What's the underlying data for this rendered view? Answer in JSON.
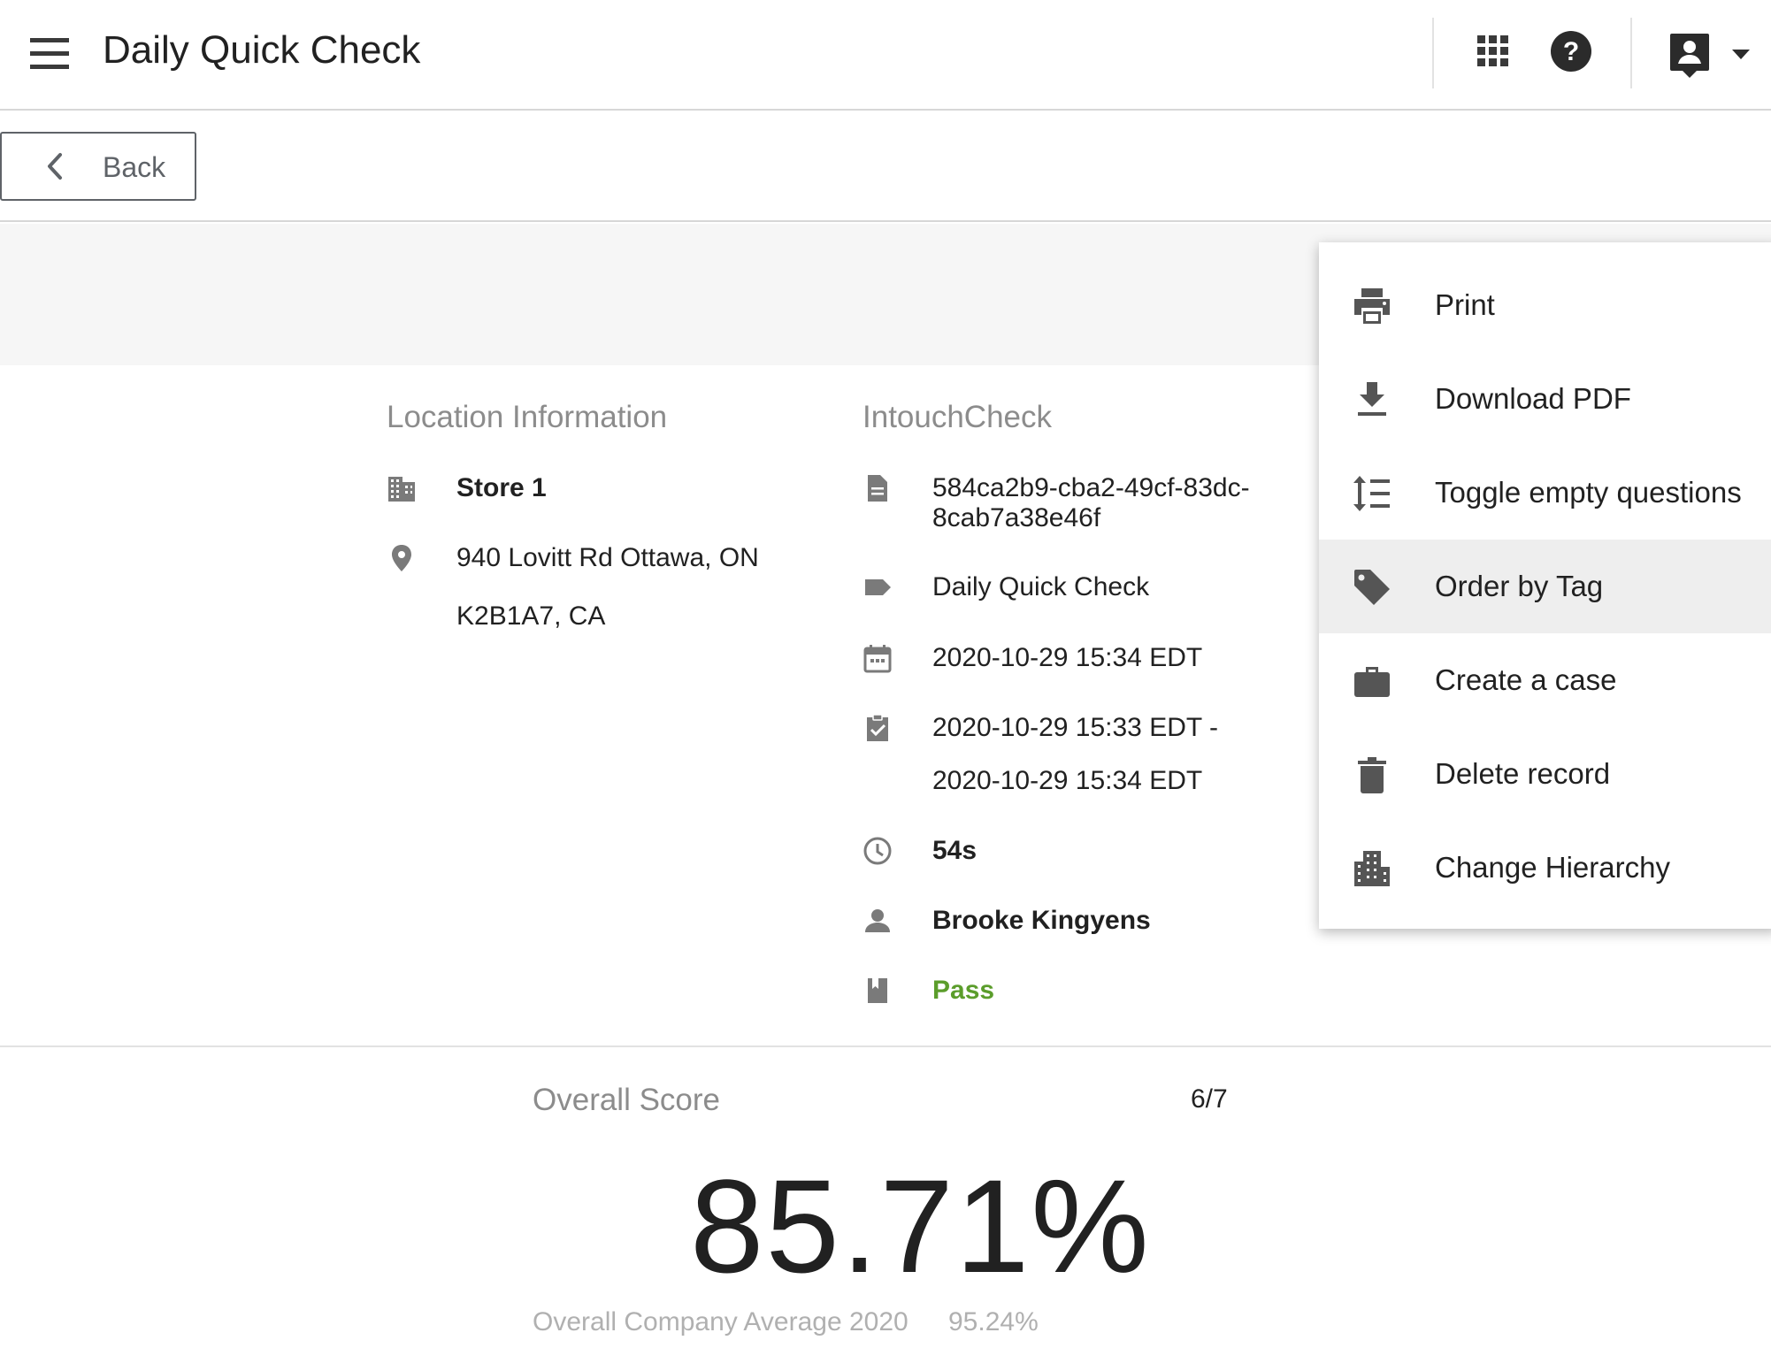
{
  "header": {
    "title": "Daily Quick Check",
    "icons": [
      "menu-icon",
      "apps-grid-icon",
      "help-icon",
      "account-icon",
      "dropdown-caret-icon"
    ]
  },
  "nav": {
    "back_label": "Back"
  },
  "location": {
    "heading": "Location Information",
    "store": "Store 1",
    "address_line1": "940 Lovitt Rd Ottawa, ON",
    "address_line2": "K2B1A7, CA"
  },
  "check": {
    "heading": "IntouchCheck",
    "id_line1": "584ca2b9-cba2-49cf-83dc-",
    "id_line2": "8cab7a38e46f",
    "form_name": "Daily Quick Check",
    "submitted": "2020-10-29 15:34 EDT",
    "period_start": "2020-10-29 15:33 EDT -",
    "period_end": "2020-10-29 15:34 EDT",
    "duration": "54s",
    "user": "Brooke Kingyens",
    "result": "Pass",
    "result_color": "#5b9d2b"
  },
  "score": {
    "heading": "Overall Score",
    "fraction": "6/7",
    "percent": "85.71%",
    "average_label": "Overall Company Average 2020",
    "average_value": "95.24%"
  },
  "menu": {
    "items": [
      {
        "label": "Print",
        "icon": "print-icon"
      },
      {
        "label": "Download PDF",
        "icon": "download-icon"
      },
      {
        "label": "Toggle empty questions",
        "icon": "line-spacing-icon"
      },
      {
        "label": "Order by Tag",
        "icon": "tag-icon"
      },
      {
        "label": "Create a case",
        "icon": "briefcase-icon"
      },
      {
        "label": "Delete record",
        "icon": "trash-icon"
      },
      {
        "label": "Change Hierarchy",
        "icon": "building-icon"
      }
    ],
    "active": "Order by Tag"
  },
  "colors": {
    "accent_text": "#212121",
    "muted": "#8c8c8c",
    "pass": "#5b9d2b"
  }
}
